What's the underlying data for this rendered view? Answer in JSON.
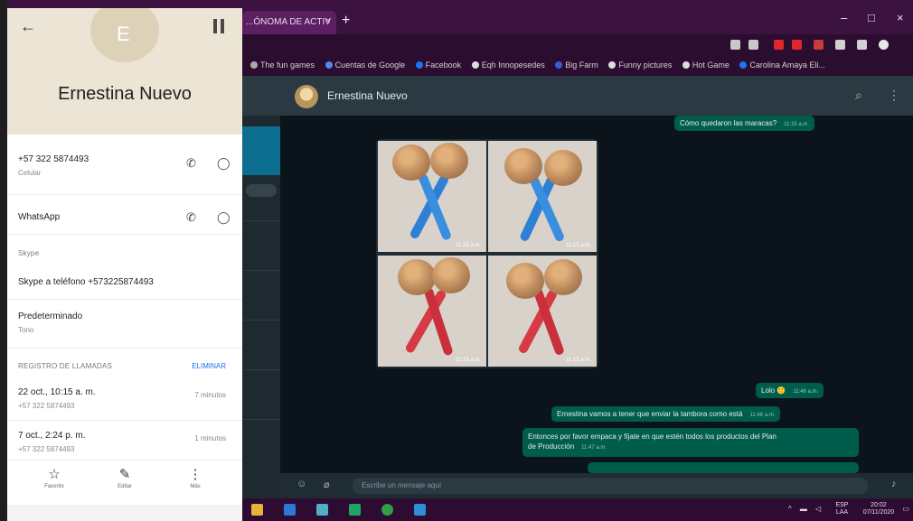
{
  "browser": {
    "tab_title": "...ÓNOMA DE ACTIV",
    "tab_close": "×",
    "new_tab": "+",
    "window_controls": [
      "–",
      "□",
      "×"
    ],
    "bookmarks": [
      "The fun games",
      "Cuentas de Google",
      "Facebook",
      "Eqh Innopesedes",
      "Big Farm",
      "Funny pictures",
      "Hot Game",
      "Carolina Amaya Eli..."
    ]
  },
  "whatsapp": {
    "chat_name": "Ernestina Nuevo",
    "messages": [
      {
        "text": "Cómo quedaron las maracas?",
        "time": "11:15 a.m."
      },
      {
        "text": "Lolo 🙂",
        "time": "11:46 a.m."
      },
      {
        "text": "Ernestina vamos a tener que enviar la tambora como está",
        "time": "11:46 a.m."
      },
      {
        "text": "Entonces por favor empaca y fíjate en que estén todos los productos del Plan",
        "text2": "de Producción",
        "time": "11:47 a.m."
      }
    ],
    "photo_times": [
      "11:15 a.m.",
      "11:15 a.m.",
      "11:15 a.m.",
      "11:15 a.m."
    ],
    "input_placeholder": "Escribe un mensaje aquí",
    "scroll_down": "⌄"
  },
  "taskbar": {
    "tray_lang": "ESP",
    "tray_region": "LAA",
    "time": "20:02",
    "date": "07/11/2020"
  },
  "contact": {
    "initial": "E",
    "name": "Ernestina Nuevo",
    "phone": "+57 322 5874493",
    "phone_type": "Celular",
    "whatsapp_label": "WhatsApp",
    "section_skype": "Skype",
    "skype_call": "Skype a teléfono +573225874493",
    "ringtone_label": "Predeterminado",
    "ringtone_sub": "Tono",
    "history_label": "REGISTRO DE LLAMADAS",
    "delete_label": "ELIMINAR",
    "calls": [
      {
        "date": "22 oct., 10:15 a. m.",
        "number": "+57 322 5874493",
        "duration": "7 minutos"
      },
      {
        "date": "7 oct., 2:24 p. m.",
        "number": "+57 322 5874493",
        "duration": "1 minutos"
      }
    ],
    "actions": [
      {
        "label": "Favorito",
        "icon": "☆"
      },
      {
        "label": "Editar",
        "icon": "✎"
      },
      {
        "label": "Más",
        "icon": "⋮"
      }
    ]
  }
}
